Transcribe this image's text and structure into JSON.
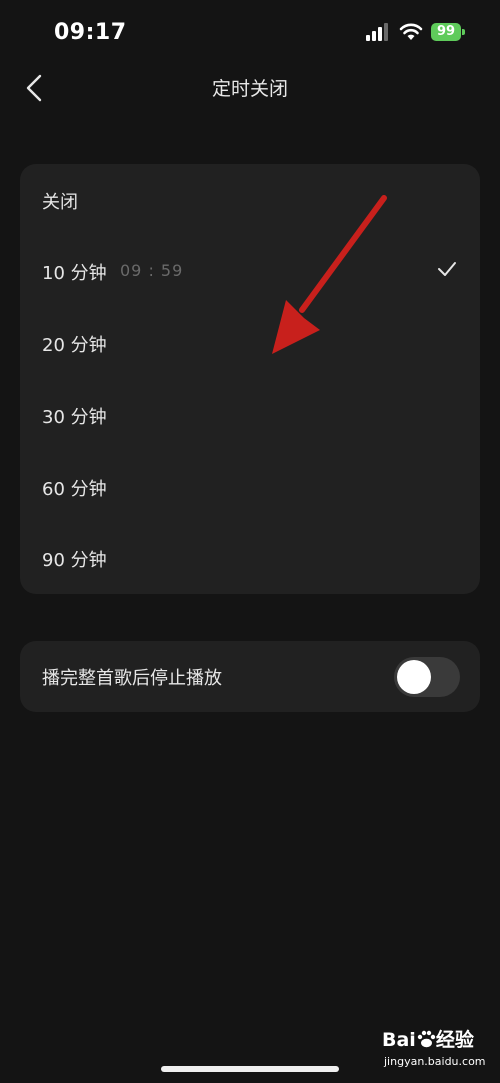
{
  "status_bar": {
    "time": "09:17",
    "battery": "99",
    "icons": [
      "cellular-signal-icon",
      "wifi-icon",
      "battery-charging-icon"
    ]
  },
  "header": {
    "back_icon": "chevron-left-icon",
    "title": "定时关闭"
  },
  "timer_options": [
    {
      "label": "关闭",
      "selected": false
    },
    {
      "label": "10 分钟",
      "countdown": "09 : 59",
      "selected": true
    },
    {
      "label": "20 分钟",
      "selected": false
    },
    {
      "label": "30 分钟",
      "selected": false
    },
    {
      "label": "60 分钟",
      "selected": false
    },
    {
      "label": "90 分钟",
      "selected": false
    }
  ],
  "stop_after_song": {
    "label": "播完整首歌后停止播放",
    "enabled": false
  },
  "watermark": {
    "logo": "Bai度经验",
    "url": "jingyan.baidu.com"
  },
  "colors": {
    "background": "#141414",
    "card": "#212121",
    "text": "#e6e6e6",
    "muted_text": "#6a6a6a",
    "battery": "#5fcb5b",
    "annotation_arrow": "#c8201c"
  }
}
